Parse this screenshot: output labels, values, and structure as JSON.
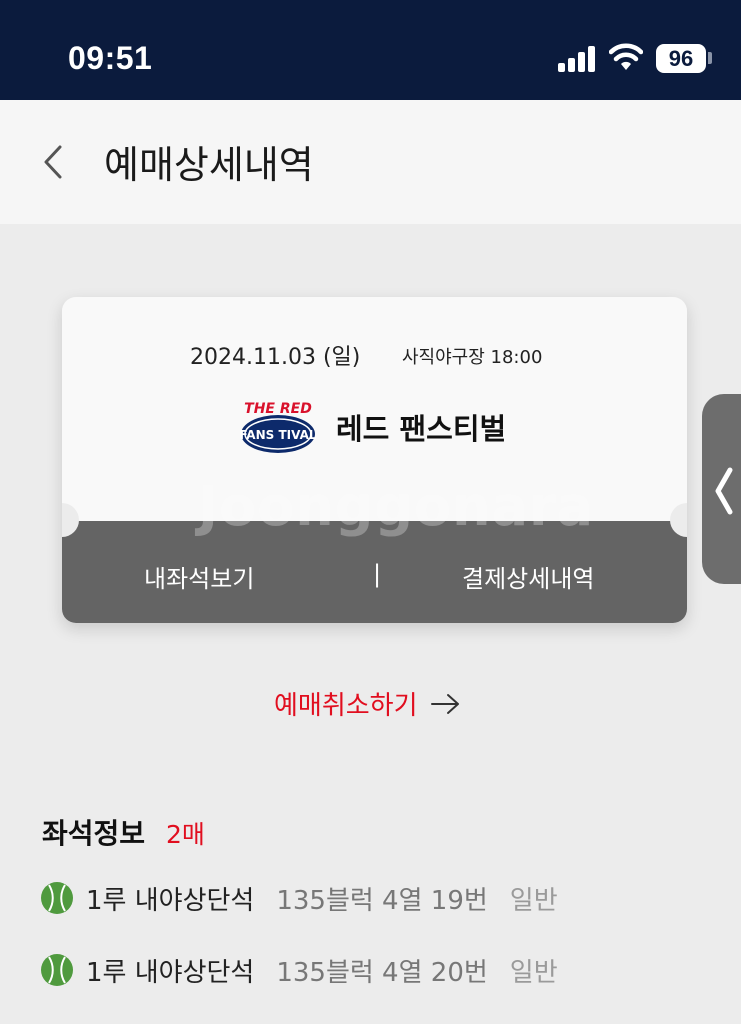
{
  "status_bar": {
    "time": "09:51",
    "battery": "96"
  },
  "header": {
    "title": "예매상세내역",
    "back_icon": "chevron-left-icon"
  },
  "ticket": {
    "date": "2024.11.03 (일)",
    "venue_time": "사직야구장 18:00",
    "logo_text_top": "THE RED",
    "logo_text_bottom": "FANS TIVAL",
    "event_name": "레드 팬스티벌",
    "watermark": "Joonggonara",
    "view_seat_label": "내좌석보기",
    "divider": "|",
    "payment_detail_label": "결제상세내역"
  },
  "cancel": {
    "label": "예매취소하기",
    "icon": "arrow-right-icon",
    "color": "#e10e1f"
  },
  "seat_info": {
    "title": "좌석정보",
    "count": "2매",
    "seats": [
      {
        "zone": "1루 내야상단석",
        "detail": "135블럭 4열 19번",
        "type": "일반"
      },
      {
        "zone": "1루 내야상단석",
        "detail": "135블럭 4열 20번",
        "type": "일반"
      }
    ]
  },
  "colors": {
    "status_bar_bg": "#0b1b3d",
    "accent_red": "#e10e1f",
    "ticket_bottom": "#646464",
    "ball_green": "#4f9a3e"
  }
}
